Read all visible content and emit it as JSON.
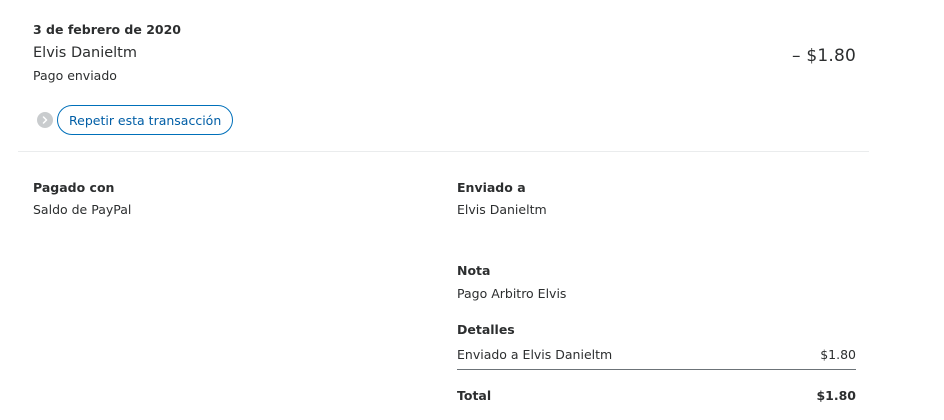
{
  "header": {
    "date": "3 de febrero de 2020",
    "name": "Elvis Danieltm",
    "type": "Pago enviado",
    "amount": "– $1.80",
    "repeat_label": "Repetir esta transacción"
  },
  "left": {
    "paid_with_label": "Pagado con",
    "paid_with_value": "Saldo de PayPal"
  },
  "right": {
    "sent_to_label": "Enviado a",
    "sent_to_value": "Elvis Danieltm",
    "note_label": "Nota",
    "note_value": "Pago Arbitro Elvis",
    "details_label": "Detalles",
    "details_row_label": "Enviado a Elvis Danieltm",
    "details_row_amount": "$1.80",
    "total_label": "Total",
    "total_amount": "$1.80"
  },
  "colors": {
    "accent": "#0070ba",
    "text": "#2c2e2f",
    "divider": "#eaeced"
  },
  "icons": {
    "repeat_dot": "chevron-right-icon"
  }
}
